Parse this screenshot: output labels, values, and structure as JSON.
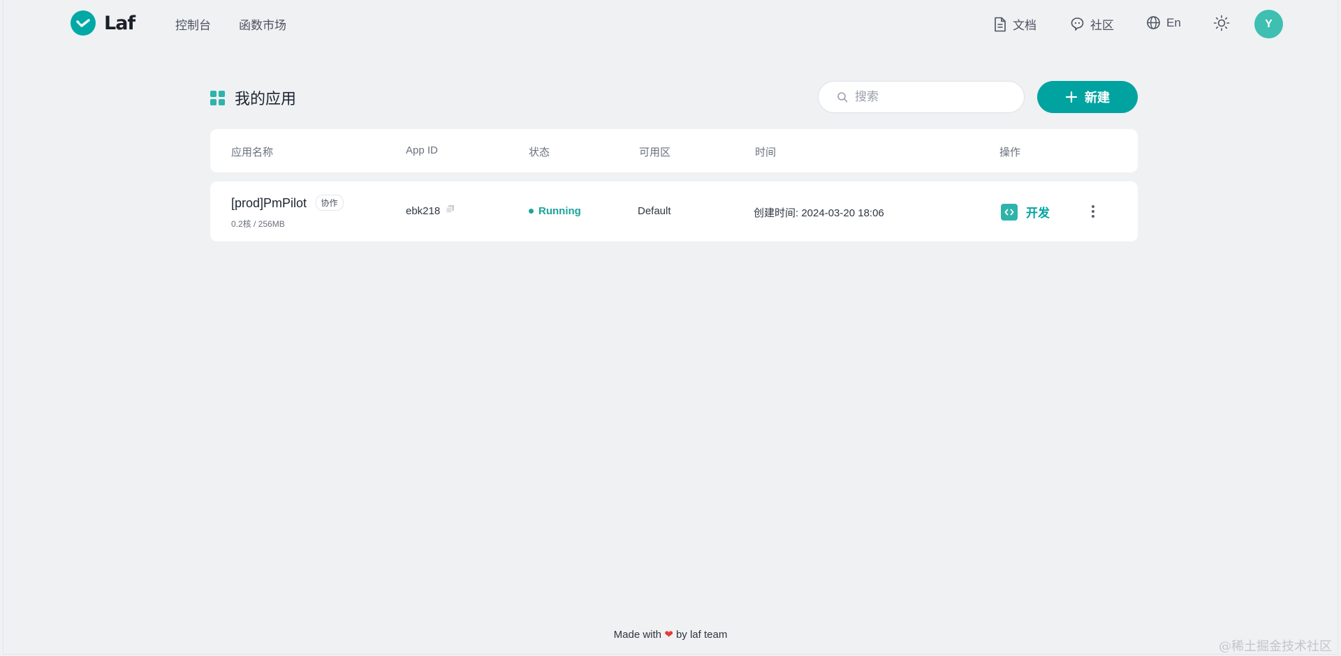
{
  "header": {
    "brand": "Laf",
    "nav": [
      "控制台",
      "函数市场"
    ],
    "docs_label": "文档",
    "community_label": "社区",
    "language_label": "En",
    "avatar_initial": "Y"
  },
  "section": {
    "title": "我的应用",
    "search_placeholder": "搜索",
    "new_button": "新建"
  },
  "table": {
    "columns": [
      "应用名称",
      "App ID",
      "状态",
      "可用区",
      "时间",
      "操作"
    ],
    "rows": [
      {
        "name": "[prod]PmPilot",
        "tag": "协作",
        "spec": "0.2核 / 256MB",
        "app_id": "ebk218",
        "status": "Running",
        "region": "Default",
        "created": "创建时间: 2024-03-20 18:06",
        "action": "开发"
      }
    ]
  },
  "footer": {
    "prefix": "Made with",
    "heart": "❤",
    "suffix": "by laf team"
  },
  "watermark": "@稀土掘金技术社区",
  "colors": {
    "accent": "#00a3a0",
    "status_running": "#1aa59a",
    "background": "#eff1f3"
  }
}
